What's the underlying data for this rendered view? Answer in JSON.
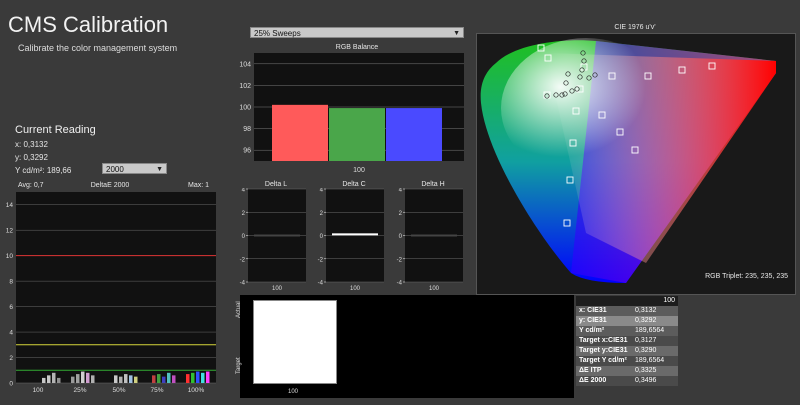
{
  "header": {
    "title": "CMS Calibration",
    "subtitle": "Calibrate the color management system"
  },
  "reading": {
    "title": "Current Reading",
    "x": "x: 0,3132",
    "y": "y: 0,3292",
    "Y": "Y cd/m²: 189,66"
  },
  "reading_dropdown": {
    "value": "2000"
  },
  "sweeps_dropdown": {
    "value": "25% Sweeps"
  },
  "colors": {
    "red": "#ff5a5a",
    "green": "#4aa64a",
    "blue": "#4a4aff",
    "grid": "#7a7a7a",
    "plot_bg": "#111111"
  },
  "rgb_balance": {
    "title": "RGB Balance",
    "xlabel": "100",
    "chart_data": {
      "type": "bar",
      "categories": [
        "R",
        "G",
        "B"
      ],
      "values": [
        100.2,
        99.9,
        99.9
      ],
      "ylim": [
        95,
        105
      ],
      "yticks": [
        96,
        98,
        100,
        102,
        104
      ]
    }
  },
  "deltae": {
    "title": "DeltaE 2000",
    "avg": "Avg: 0,7",
    "max": "Max: 1",
    "yticks": [
      0,
      2,
      4,
      6,
      8,
      10,
      12,
      14
    ],
    "xticks": [
      "100",
      "25%",
      "50%",
      "75%",
      "100%"
    ],
    "chart_data": {
      "type": "bar",
      "ylim": [
        0,
        15
      ],
      "thresholds": [
        {
          "value": 10,
          "color": "#dd3333"
        },
        {
          "value": 3,
          "color": "#d6d63a"
        },
        {
          "value": 1,
          "color": "#33aa33"
        }
      ],
      "groups": [
        {
          "values": [
            0.4,
            0.6,
            0.8,
            0.4
          ],
          "colors": [
            "#c8c8c8",
            "#c8c8c8",
            "#b4b4b4",
            "#909090"
          ]
        },
        {
          "values": [
            0.5,
            0.7,
            0.9,
            0.8,
            0.6
          ],
          "colors": [
            "#9a9a9a",
            "#a0a0a0",
            "#cfcfcf",
            "#d0a0d0",
            "#b0b0b0"
          ]
        },
        {
          "values": [
            0.6,
            0.5,
            0.7,
            0.6,
            0.5
          ],
          "colors": [
            "#c8c8c8",
            "#b0b0b0",
            "#c0c0c0",
            "#a0c0e0",
            "#cfcf80"
          ]
        },
        {
          "values": [
            0.6,
            0.7,
            0.5,
            0.8,
            0.6
          ],
          "colors": [
            "#c04040",
            "#40a040",
            "#4040c0",
            "#50c0c0",
            "#c050c0"
          ]
        },
        {
          "values": [
            0.7,
            0.8,
            0.9,
            0.8,
            0.9
          ],
          "colors": [
            "#ff3030",
            "#30c030",
            "#3050ff",
            "#40e0e0",
            "#ff40ff"
          ]
        }
      ]
    }
  },
  "delta_panels": [
    {
      "title": "Delta L",
      "xlabel": "100",
      "yticks": [
        "4",
        "2",
        "0",
        "-2",
        "-4"
      ],
      "value": 0
    },
    {
      "title": "Delta C",
      "xlabel": "100",
      "yticks": [
        "4",
        "2",
        "0",
        "-2",
        "-4"
      ],
      "value": 0.1
    },
    {
      "title": "Delta H",
      "xlabel": "100",
      "yticks": [
        "4",
        "2",
        "0",
        "-2",
        "-4"
      ],
      "value": 0
    }
  ],
  "cie": {
    "title": "CIE 1976 u'v'",
    "triplet": "RGB Triplet: 235, 235, 235",
    "chart_data": {
      "type": "scatter",
      "targets": [
        [
          0.448,
          0.523
        ],
        [
          0.125,
          0.561
        ],
        [
          0.175,
          0.158
        ],
        [
          0.197,
          0.468
        ]
      ],
      "measured": [
        [
          0.448,
          0.523
        ],
        [
          0.125,
          0.561
        ],
        [
          0.175,
          0.158
        ],
        [
          0.197,
          0.468
        ]
      ]
    }
  },
  "swatch": {
    "label_actual": "Actual",
    "label_target": "Target",
    "xlabel": "100"
  },
  "info_table": {
    "column": "100",
    "rows": [
      {
        "label": "x: CIE31",
        "value": "0,3132"
      },
      {
        "label": "y: CIE31",
        "value": "0,3292"
      },
      {
        "label": "Y cd/m²",
        "value": "189,6564"
      },
      {
        "label": "Target x:CIE31",
        "value": "0,3127"
      },
      {
        "label": "Target y:CIE31",
        "value": "0,3290"
      },
      {
        "label": "Target Y cd/m²",
        "value": "189,6564"
      },
      {
        "label": "ΔE ITP",
        "value": "0,3325"
      },
      {
        "label": "ΔE 2000",
        "value": "0,3496"
      }
    ]
  }
}
